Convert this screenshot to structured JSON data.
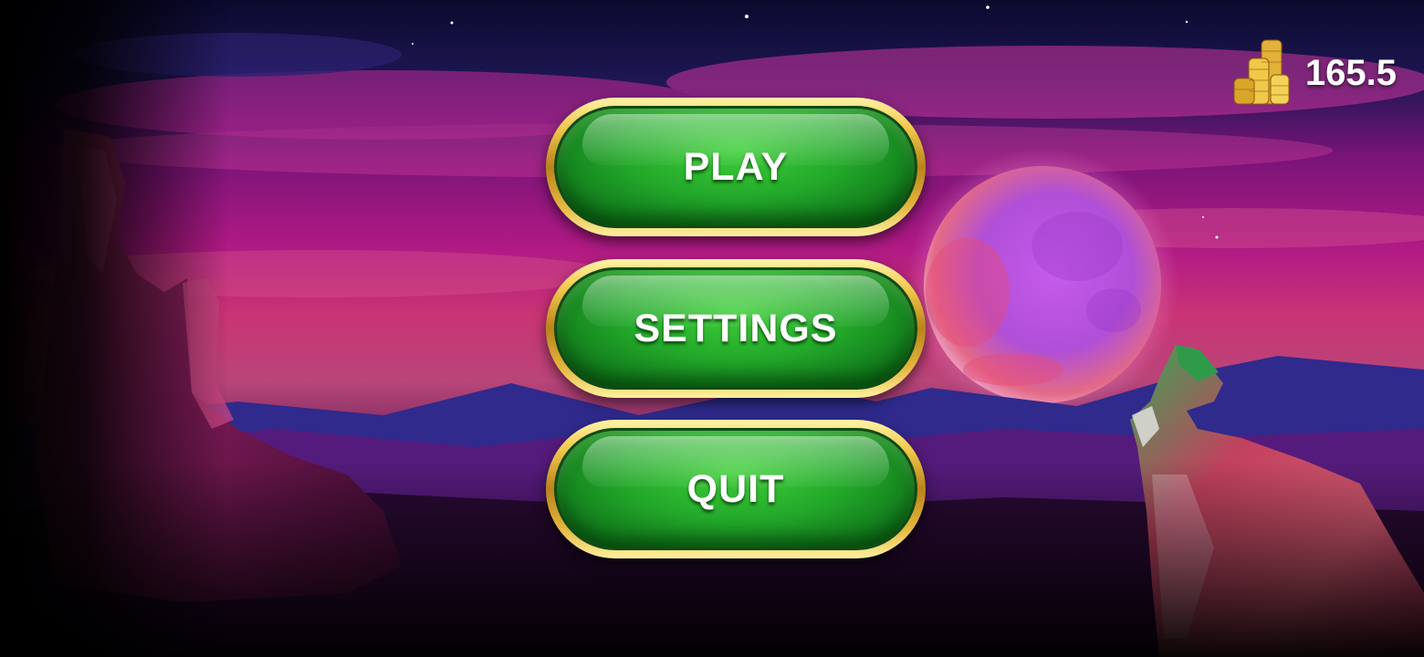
{
  "balance": {
    "icon": "gold-coin-stack-icon",
    "amount": "165.5"
  },
  "menu": {
    "play_label": "PLAY",
    "settings_label": "SETTINGS",
    "quit_label": "QUIT"
  },
  "colors": {
    "button_green": "#23a82a",
    "button_gold_rim": "#f0c84a",
    "sky_magenta": "#a0157d",
    "moon_violet": "#c24fe6"
  }
}
